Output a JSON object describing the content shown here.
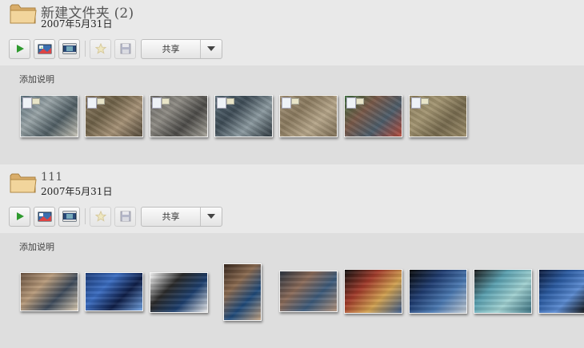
{
  "folders": [
    {
      "title": "新建文件夹 (2)",
      "date": "2007年5月31日",
      "share_label": "共享",
      "caption_placeholder": "添加说明",
      "photos": [
        {
          "name": "aerial-highway",
          "colors": [
            "#5b6f7a",
            "#9aa5a8",
            "#4f5d63",
            "#c7c4b8"
          ]
        },
        {
          "name": "aerial-industrial",
          "colors": [
            "#8a7a62",
            "#6e6148",
            "#a69277",
            "#544a3a"
          ]
        },
        {
          "name": "aerial-city-blocks",
          "colors": [
            "#6d6c68",
            "#8e8b84",
            "#4c4b48",
            "#a8a59c"
          ]
        },
        {
          "name": "aerial-bridge",
          "colors": [
            "#5c6d78",
            "#3e4c56",
            "#8c9aa0",
            "#2f3a41"
          ]
        },
        {
          "name": "aerial-field",
          "colors": [
            "#a09076",
            "#8a7a5f",
            "#b6a68a",
            "#7c6d55"
          ]
        },
        {
          "name": "aerial-stadium",
          "colors": [
            "#3d6b3f",
            "#7a5a4a",
            "#4d5d6a",
            "#b44a3a"
          ]
        },
        {
          "name": "aerial-railway",
          "colors": [
            "#8c7f5f",
            "#a39572",
            "#766a4e",
            "#9c8d6a"
          ]
        }
      ]
    },
    {
      "title": "111",
      "date": "2007年5月31日",
      "share_label": "共享",
      "caption_placeholder": "添加说明",
      "photos": [
        {
          "name": "surface-table-people",
          "colors": [
            "#6a5240",
            "#b79a7a",
            "#3d4a5a",
            "#d8c8b0"
          ]
        },
        {
          "name": "surface-hand-touch",
          "colors": [
            "#1c3c7a",
            "#3a6cc0",
            "#0f1f48",
            "#6fa0e0"
          ]
        },
        {
          "name": "surface-device-white",
          "colors": [
            "#ffffff",
            "#2a2a2a",
            "#1d3f6e",
            "#e8e8e8"
          ]
        },
        {
          "name": "surface-group-portrait",
          "colors": [
            "#3a2a20",
            "#8a6a50",
            "#1f4a7a",
            "#c0a080"
          ]
        },
        {
          "name": "surface-hands-closeup",
          "colors": [
            "#2c3440",
            "#8a6a58",
            "#3c5a7a",
            "#b0907a"
          ]
        },
        {
          "name": "surface-photos-ui",
          "colors": [
            "#111111",
            "#a03a2a",
            "#d0a050",
            "#3a5a8a"
          ]
        },
        {
          "name": "surface-media-ui",
          "colors": [
            "#0a0a0a",
            "#1f3c70",
            "#4a78b0",
            "#c0c8d0"
          ]
        },
        {
          "name": "surface-map-ui",
          "colors": [
            "#1a1a1a",
            "#5aa0b0",
            "#a0d0d0",
            "#3a7080"
          ]
        },
        {
          "name": "surface-circle-ui",
          "colors": [
            "#0c1a3a",
            "#2a5aa0",
            "#5a8ad0",
            "#101010"
          ]
        }
      ]
    }
  ]
}
